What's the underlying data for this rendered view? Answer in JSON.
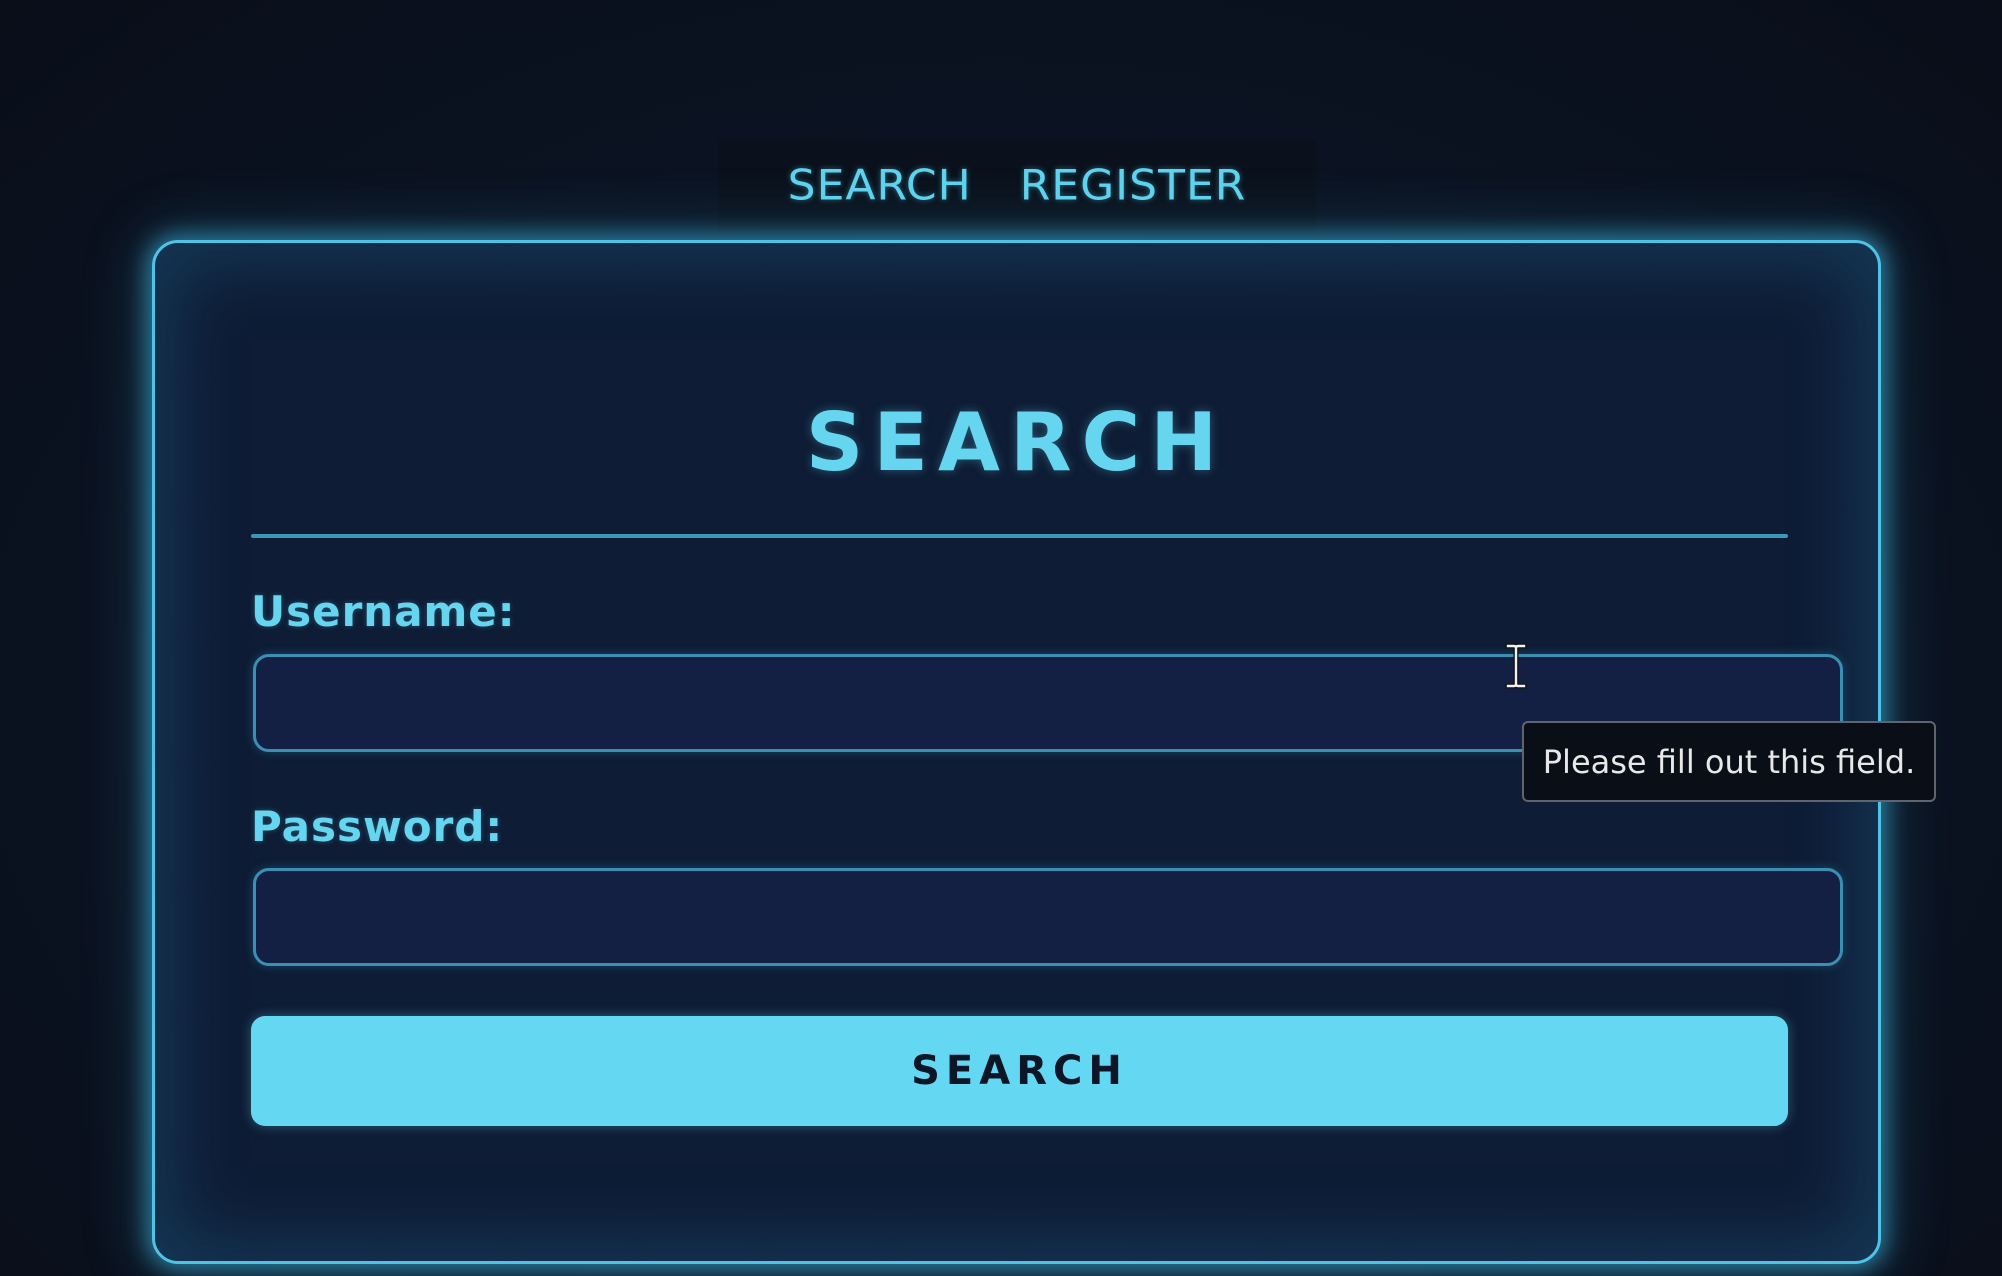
{
  "nav": {
    "items": [
      {
        "label": "SEARCH"
      },
      {
        "label": "REGISTER"
      }
    ]
  },
  "form": {
    "title": "SEARCH",
    "username": {
      "label": "Username:",
      "value": "",
      "placeholder": ""
    },
    "password": {
      "label": "Password:",
      "value": "",
      "placeholder": ""
    },
    "submit_label": "SEARCH"
  },
  "tooltip": {
    "text": "Please fill out this field."
  },
  "cursor": {
    "icon": "ibeam-cursor-icon"
  },
  "colors": {
    "accent": "#64d8f2",
    "background": "#0b1220",
    "card": "#0e1c35",
    "input": "#132043"
  }
}
